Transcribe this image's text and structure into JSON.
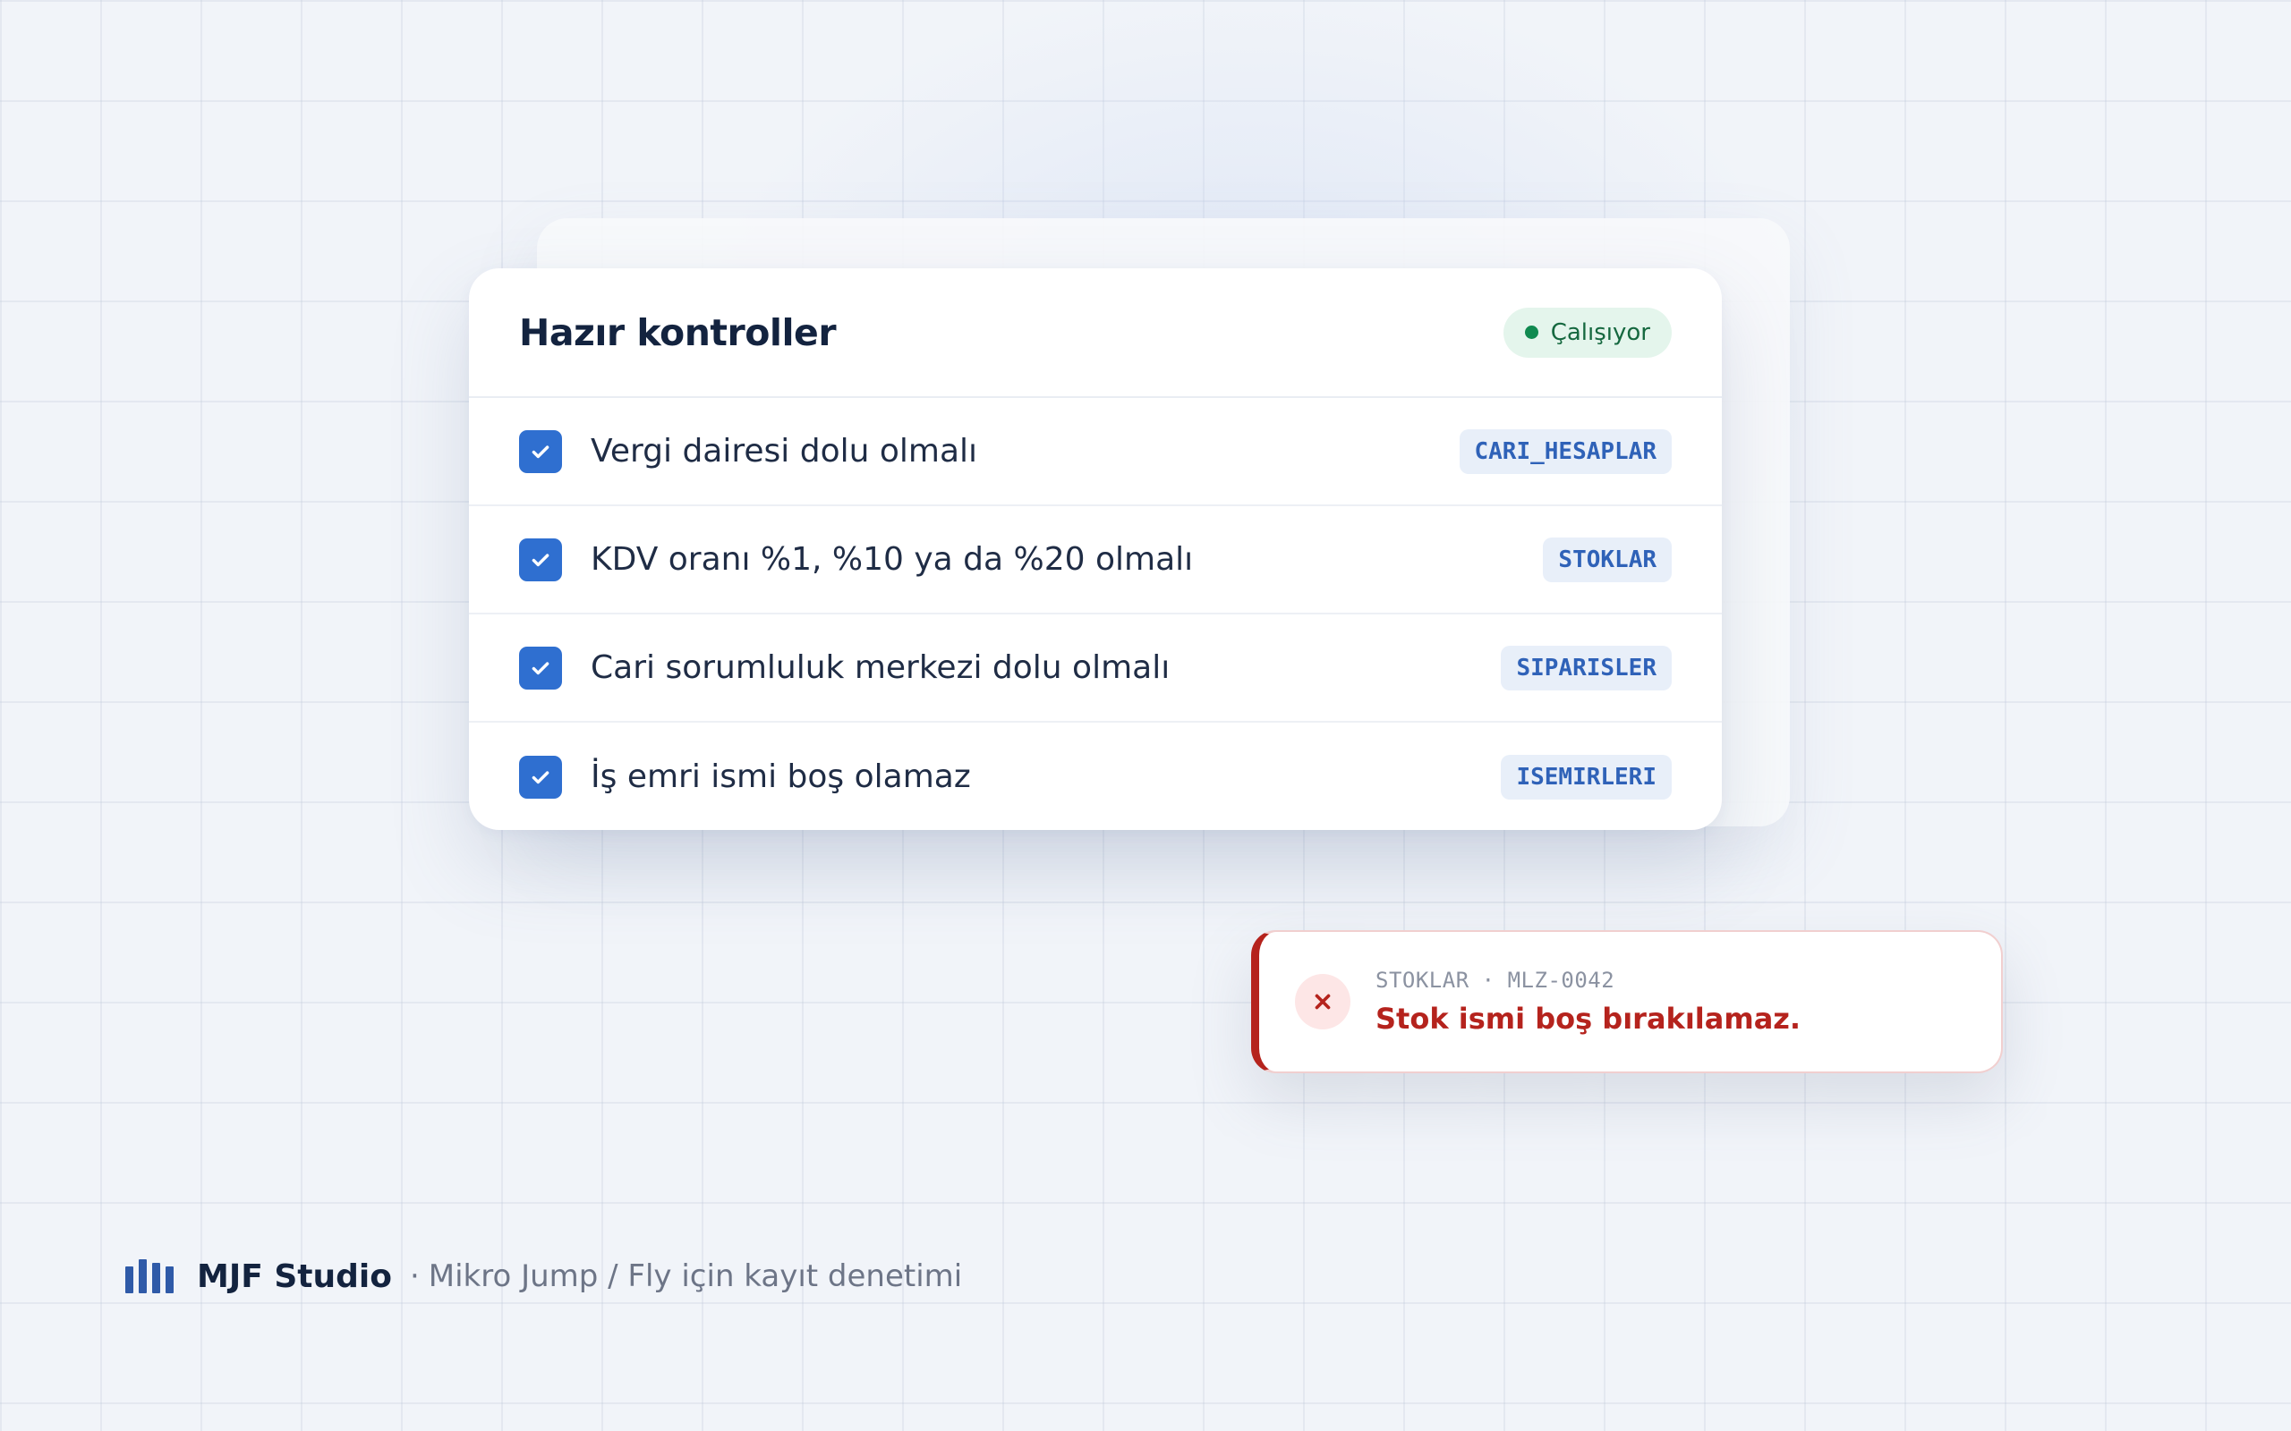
{
  "panel": {
    "title": "Hazır kontroller",
    "status": {
      "label": "Çalışıyor",
      "color": "#108a50"
    },
    "checks": [
      {
        "label": "Vergi dairesi dolu olmalı",
        "table": "CARI_HESAPLAR",
        "checked": true
      },
      {
        "label": "KDV oranı %1, %10 ya da %20 olmalı",
        "table": "STOKLAR",
        "checked": true
      },
      {
        "label": "Cari sorumluluk merkezi dolu olmalı",
        "table": "SIPARISLER",
        "checked": true
      },
      {
        "label": "İş emri ismi boş olamaz",
        "table": "ISEMIRLERI",
        "checked": true
      }
    ]
  },
  "toast": {
    "table": "STOKLAR",
    "separator": "·",
    "record": "MLZ-0042",
    "message": "Stok ismi boş bırakılamaz.",
    "icon": "close-x-icon",
    "color": "#b5231d"
  },
  "footer": {
    "brand": "MJF Studio",
    "separator": "·",
    "tagline": "Mikro Jump / Fly için kayıt denetimi",
    "logo_icon": "bar-chart-logo-icon",
    "accent": "#2f5aa8"
  }
}
